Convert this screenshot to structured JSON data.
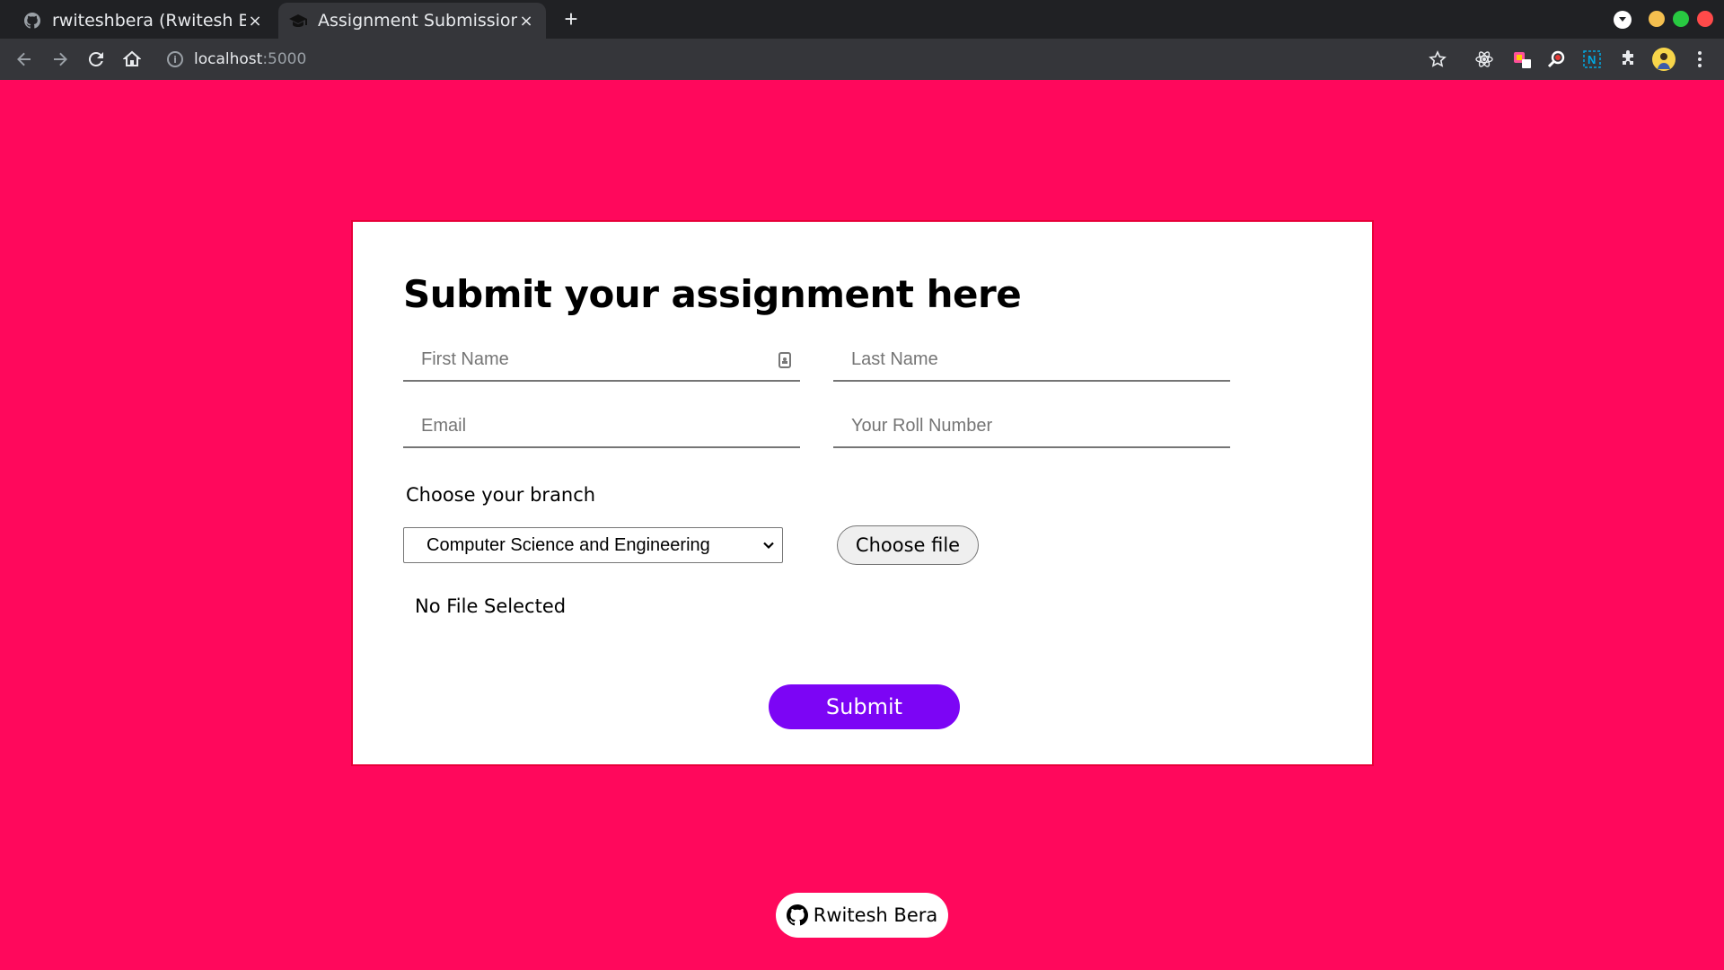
{
  "browser": {
    "tabs": [
      {
        "title": "rwiteshbera (Rwitesh Bera)",
        "icon": "github-icon",
        "active": false
      },
      {
        "title": "Assignment Submission",
        "icon": "graduation-cap-icon",
        "active": true
      }
    ],
    "new_tab_label": "+",
    "close_label": "×",
    "url": {
      "host": "localhost",
      "port": ":5000"
    },
    "window_controls": {
      "minimize_color": "#f4bf4f",
      "maximize_color": "#28c941",
      "close_color": "#ff4a4a"
    }
  },
  "form": {
    "title": "Submit your assignment here",
    "first_name_placeholder": "First Name",
    "last_name_placeholder": "Last Name",
    "email_placeholder": "Email",
    "roll_placeholder": "Your Roll Number",
    "branch_label": "Choose your branch",
    "branch_selected": "Computer Science and Engineering",
    "file_button": "Choose file",
    "file_status": "No File Selected",
    "submit_label": "Submit"
  },
  "footer": {
    "author": "Rwitesh Bera"
  },
  "colors": {
    "page_bg": "#ff085c",
    "accent": "#7c05f5"
  }
}
